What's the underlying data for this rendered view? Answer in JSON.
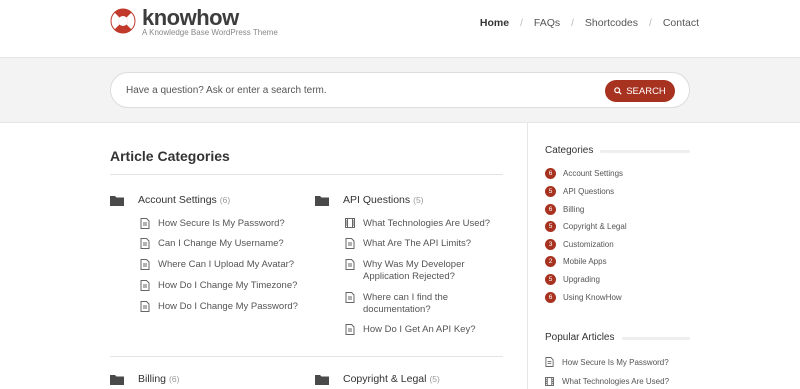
{
  "header": {
    "brand": "knowhow",
    "tagline": "A Knowledge Base WordPress Theme",
    "nav": [
      "Home",
      "FAQs",
      "Shortcodes",
      "Contact"
    ],
    "nav_separator": "/"
  },
  "search": {
    "placeholder": "Have a question? Ask or enter a search term.",
    "button_label": "SEARCH"
  },
  "main": {
    "title": "Article Categories",
    "categories": [
      {
        "name": "Account Settings",
        "count": "(6)",
        "articles": [
          "How Secure Is My Password?",
          "Can I Change My Username?",
          "Where Can I Upload My Avatar?",
          "How Do I Change My Timezone?",
          "How Do I Change My Password?"
        ]
      },
      {
        "name": "API Questions",
        "count": "(5)",
        "articles": [
          "What Technologies Are Used?",
          "What Are The API Limits?",
          "Why Was My Developer Application Rejected?",
          "Where can I find the documentation?",
          "How Do I Get An API Key?"
        ]
      },
      {
        "name": "Billing",
        "count": "(6)"
      },
      {
        "name": "Copyright & Legal",
        "count": "(5)"
      }
    ]
  },
  "sidebar": {
    "categories_title": "Categories",
    "categories": [
      {
        "count": "6",
        "label": "Account Settings"
      },
      {
        "count": "5",
        "label": "API Questions"
      },
      {
        "count": "6",
        "label": "Billing"
      },
      {
        "count": "5",
        "label": "Copyright & Legal"
      },
      {
        "count": "3",
        "label": "Customization"
      },
      {
        "count": "2",
        "label": "Mobile Apps"
      },
      {
        "count": "5",
        "label": "Upgrading"
      },
      {
        "count": "6",
        "label": "Using KnowHow"
      }
    ],
    "popular_title": "Popular Articles",
    "popular": [
      "How Secure Is My Password?",
      "What Technologies Are Used?"
    ]
  },
  "colors": {
    "accent": "#a83220",
    "band": "#f3f3f3",
    "text": "#333333",
    "folder": "#4a4a4a"
  }
}
